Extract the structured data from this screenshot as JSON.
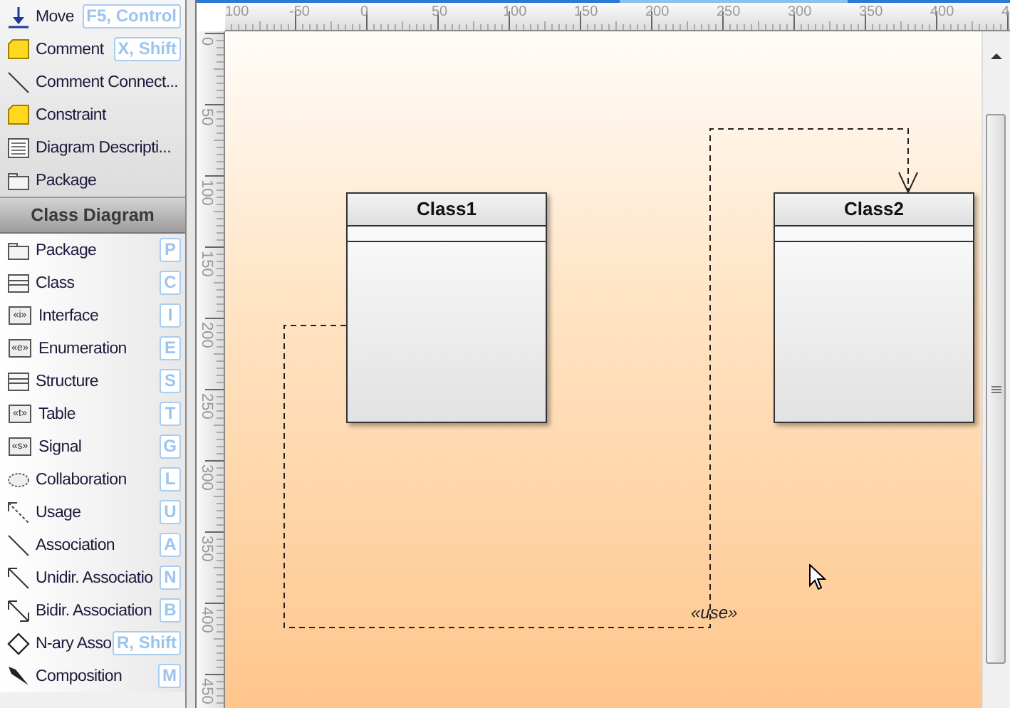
{
  "palette": {
    "sections": [
      {
        "items": [
          {
            "kind": "move",
            "label": "Move",
            "shortcut": "F5, Control"
          },
          {
            "kind": "note",
            "label": "Comment",
            "shortcut": "X, Shift"
          },
          {
            "kind": "line",
            "label": "Comment  Connect..."
          },
          {
            "kind": "note",
            "label": "Constraint"
          },
          {
            "kind": "doc",
            "label": "Diagram Descripti..."
          },
          {
            "kind": "package",
            "label": "Package"
          }
        ]
      },
      {
        "title": "Class Diagram",
        "items": [
          {
            "kind": "package",
            "label": "Package",
            "shortcut": "P"
          },
          {
            "kind": "class",
            "label": "Class",
            "shortcut": "C"
          },
          {
            "kind": "stereotype",
            "icon_text": "«i»",
            "label": "Interface",
            "shortcut": "I"
          },
          {
            "kind": "stereotype",
            "icon_text": "«e»",
            "label": "Enumeration",
            "shortcut": "E"
          },
          {
            "kind": "class",
            "label": "Structure",
            "shortcut": "S"
          },
          {
            "kind": "stereotype",
            "icon_text": "«t»",
            "label": "Table",
            "shortcut": "T"
          },
          {
            "kind": "stereotype",
            "icon_text": "«s»",
            "label": "Signal",
            "shortcut": "G"
          },
          {
            "kind": "ellipse",
            "label": "Collaboration",
            "shortcut": "L"
          },
          {
            "kind": "usage",
            "label": "Usage",
            "shortcut": "U"
          },
          {
            "kind": "line",
            "label": "Association",
            "shortcut": "A"
          },
          {
            "kind": "arrow",
            "label": "Unidir. Associatio",
            "shortcut": "N"
          },
          {
            "kind": "biarrow",
            "label": "Bidir. Association",
            "shortcut": "B"
          },
          {
            "kind": "diamond",
            "label": "N-ary Asso",
            "shortcut": "R, Shift"
          },
          {
            "kind": "filled-diamond",
            "label": "Composition",
            "shortcut": "M"
          }
        ]
      }
    ]
  },
  "rulers": {
    "horizontal": [
      "100",
      "-50",
      "0",
      "50",
      "100",
      "150",
      "200",
      "250",
      "300",
      "350",
      "400",
      "4"
    ],
    "vertical": [
      "0",
      "50",
      "100",
      "150",
      "200",
      "250",
      "300",
      "350",
      "400",
      "450"
    ]
  },
  "diagram": {
    "classes": [
      {
        "name": "Class1"
      },
      {
        "name": "Class2"
      }
    ],
    "connectors": [
      {
        "kind": "usage",
        "label": "«use»"
      }
    ]
  }
}
